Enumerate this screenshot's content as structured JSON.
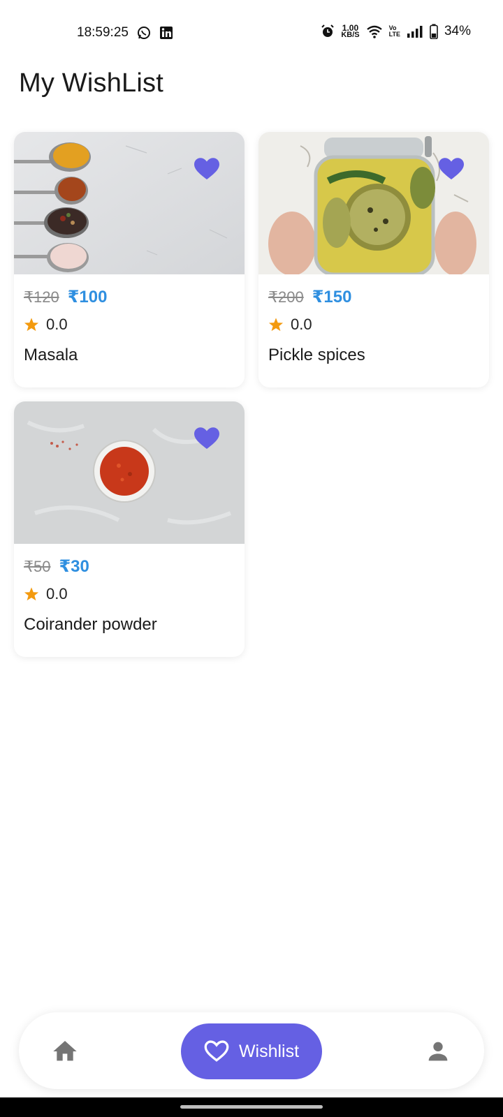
{
  "status_bar": {
    "time": "18:59:25",
    "net_speed_value": "1.00",
    "net_speed_unit": "KB/S",
    "volte_top": "Vo",
    "volte_bottom": "LTE",
    "battery": "34%"
  },
  "page": {
    "title": "My WishList"
  },
  "products": [
    {
      "name": "Masala",
      "old_price": "₹120",
      "new_price": "₹100",
      "rating": "0.0",
      "image": "spice-spoons"
    },
    {
      "name": "Pickle spices",
      "old_price": "₹200",
      "new_price": "₹150",
      "rating": "0.0",
      "image": "pickle-jar"
    },
    {
      "name": "Coirander powder",
      "old_price": "₹50",
      "new_price": "₹30",
      "rating": "0.0",
      "image": "chili-bowl"
    }
  ],
  "bottom_nav": {
    "wishlist_label": "Wishlist"
  },
  "colors": {
    "accent": "#6560e3",
    "price": "#2f8fe0",
    "star": "#f39a0f"
  }
}
